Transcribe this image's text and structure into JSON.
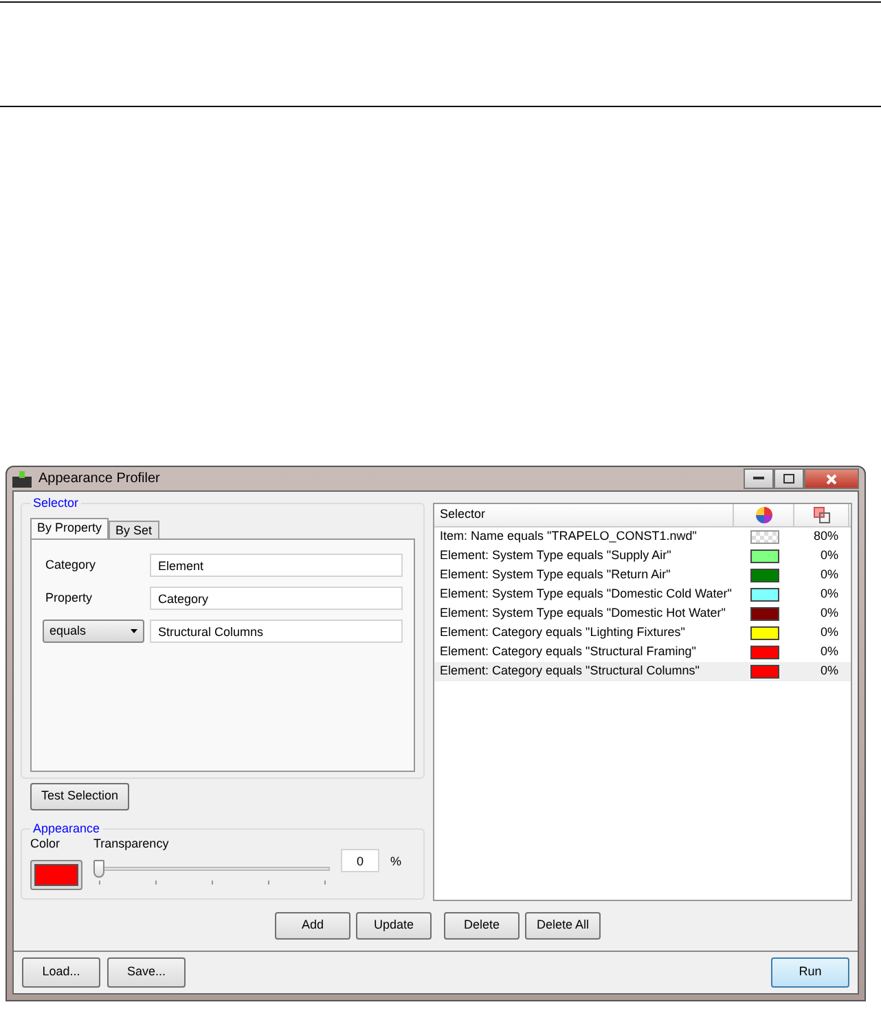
{
  "window": {
    "title": "Appearance Profiler"
  },
  "selector_group": {
    "title": "Selector",
    "tabs": [
      {
        "label": "By Property",
        "selected": true
      },
      {
        "label": "By Set",
        "selected": false
      }
    ],
    "fields": [
      {
        "kind": "label",
        "label": "Category",
        "value": "Element"
      },
      {
        "kind": "label",
        "label": "Property",
        "value": "Category"
      },
      {
        "kind": "dropdown",
        "label": "equals",
        "value": "Structural Columns"
      }
    ],
    "test_button": "Test Selection"
  },
  "appearance_group": {
    "title": "Appearance",
    "color_label": "Color",
    "color": "#ff0000",
    "transparency_label": "Transparency",
    "transparency": {
      "level": 0
    },
    "transparency_value": "0",
    "unit": "%"
  },
  "list": {
    "columns": [
      "Selector"
    ],
    "rows": [
      {
        "text": "Item: Name equals \"TRAPELO_CONST1.nwd\"",
        "kind": "checker",
        "transparency": "80%",
        "selected": false
      },
      {
        "text": "Element: System Type equals \"Supply Air\"",
        "kind": "solid",
        "color": "#80ff80",
        "transparency": "0%",
        "selected": false
      },
      {
        "text": "Element: System Type equals \"Return Air\"",
        "kind": "solid",
        "color": "#008000",
        "transparency": "0%",
        "selected": false
      },
      {
        "text": "Element: System Type equals \"Domestic Cold Water\"",
        "kind": "solid",
        "color": "#80ffff",
        "transparency": "0%",
        "selected": false
      },
      {
        "text": "Element: System Type equals \"Domestic Hot Water\"",
        "kind": "solid",
        "color": "#800000",
        "transparency": "0%",
        "selected": false
      },
      {
        "text": "Element: Category equals \"Lighting Fixtures\"",
        "kind": "solid",
        "color": "#ffff00",
        "transparency": "0%",
        "selected": false
      },
      {
        "text": "Element: Category equals \"Structural Framing\"",
        "kind": "solid",
        "color": "#ff0000",
        "transparency": "0%",
        "selected": false
      },
      {
        "text": "Element: Category equals \"Structural Columns\"",
        "kind": "solid",
        "color": "#ff0000",
        "transparency": "0%",
        "selected": true
      }
    ]
  },
  "list_buttons": [
    "Add",
    "Update",
    "Delete",
    "Delete All"
  ],
  "footer_buttons": [
    {
      "label": "Load...",
      "kind": "normal"
    },
    {
      "label": "Save...",
      "kind": "normal"
    },
    {
      "label": "Run",
      "kind": "default"
    }
  ]
}
